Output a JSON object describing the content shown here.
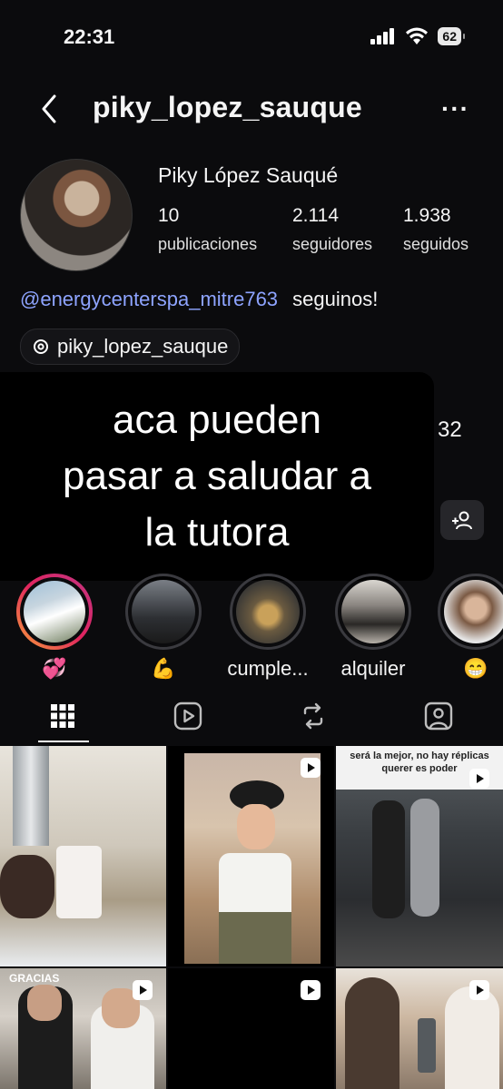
{
  "status": {
    "time": "22:31",
    "battery": "62"
  },
  "header": {
    "username": "piky_lopez_sauque"
  },
  "profile": {
    "name": "Piky López Sauqué",
    "stats": [
      {
        "value": "10",
        "label": "publicaciones"
      },
      {
        "value": "2.114",
        "label": "seguidores"
      },
      {
        "value": "1.938",
        "label": "seguidos"
      }
    ],
    "bio_mention": "@energycenterspa_mitre763",
    "bio_text": "seguinos!",
    "threads_handle": "piky_lopez_sauque",
    "partial_number": "32"
  },
  "caption": {
    "line1": "aca pueden",
    "line2": "pasar a saludar a",
    "line3": "la tutora"
  },
  "highlights": [
    {
      "label": "💞"
    },
    {
      "label": "💪"
    },
    {
      "label": "cumple..."
    },
    {
      "label": "alquiler"
    },
    {
      "label": "😁"
    }
  ],
  "tabs": [
    "grid-icon",
    "reels-icon",
    "reposts-icon",
    "tagged-icon"
  ],
  "posts": [
    {
      "overlay_text": ""
    },
    {
      "overlay_text": ""
    },
    {
      "overlay_text": "será la mejor, no hay réplicas querer es poder"
    },
    {
      "overlay_text": "GRACIAS"
    },
    {
      "overlay_text": ""
    },
    {
      "overlay_text": ""
    }
  ]
}
